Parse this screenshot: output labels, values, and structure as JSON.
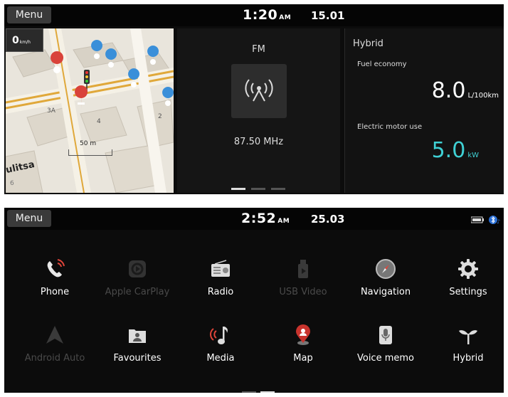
{
  "screen1": {
    "menu_label": "Menu",
    "time": "1:20",
    "ampm": "AM",
    "date": "15.01",
    "map": {
      "speed_value": "0",
      "speed_unit": "km/h",
      "scale_label": "50 m",
      "street_label": "ulitsa",
      "building_labels": [
        "3A",
        "4",
        "2",
        "6"
      ]
    },
    "radio": {
      "band": "FM",
      "frequency": "87.50 MHz"
    },
    "hybrid": {
      "title": "Hybrid",
      "fuel_label": "Fuel economy",
      "fuel_value": "8.0",
      "fuel_unit": "L/100km",
      "motor_label": "Electric motor use",
      "motor_value": "5.0",
      "motor_unit": "kW"
    },
    "pager": {
      "pages": 3,
      "active": 0
    }
  },
  "screen2": {
    "menu_label": "Menu",
    "time": "2:52",
    "ampm": "AM",
    "date": "25.03",
    "apps": [
      {
        "label": "Phone",
        "icon": "phone-icon",
        "enabled": true
      },
      {
        "label": "Apple CarPlay",
        "icon": "carplay-icon",
        "enabled": false
      },
      {
        "label": "Radio",
        "icon": "radio-icon",
        "enabled": true
      },
      {
        "label": "USB Video",
        "icon": "usb-video-icon",
        "enabled": false
      },
      {
        "label": "Navigation",
        "icon": "compass-icon",
        "enabled": true
      },
      {
        "label": "Settings",
        "icon": "gear-icon",
        "enabled": true
      },
      {
        "label": "Android Auto",
        "icon": "android-auto-icon",
        "enabled": false
      },
      {
        "label": "Favourites",
        "icon": "favourites-icon",
        "enabled": true
      },
      {
        "label": "Media",
        "icon": "music-note-icon",
        "enabled": true
      },
      {
        "label": "Map",
        "icon": "map-pin-icon",
        "enabled": true
      },
      {
        "label": "Voice memo",
        "icon": "voice-memo-icon",
        "enabled": true
      },
      {
        "label": "Hybrid",
        "icon": "sprout-icon",
        "enabled": true
      }
    ],
    "pager": {
      "pages": 2,
      "active": 1
    }
  },
  "colors": {
    "accent_cyan": "#3fd0d4",
    "phone_red": "#e0453a",
    "map_red": "#c8332d"
  }
}
